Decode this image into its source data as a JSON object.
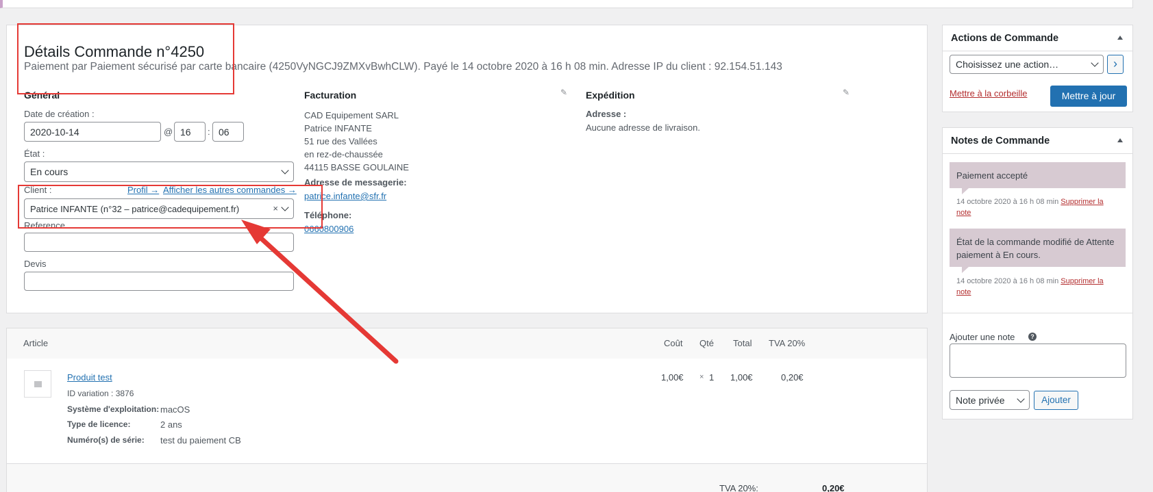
{
  "order": {
    "title": "Détails Commande n°4250",
    "subtitle": "Paiement par Paiement sécurisé par carte bancaire (4250VyNGCJ9ZMXvBwhCLW). Payé le 14 octobre 2020 à 16 h 08 min. Adresse IP du client : 92.154.51.143"
  },
  "general": {
    "heading": "Général",
    "date_label": "Date de création :",
    "date_value": "2020-10-14",
    "at": "@",
    "hour": "16",
    "colon": ":",
    "minute": "06",
    "state_label": "État :",
    "state_value": "En cours",
    "client_label": "Client :",
    "profile_link": "Profil →",
    "other_orders_link": "Afficher les autres commandes →",
    "client_value": "Patrice INFANTE (n°32 – patrice@cadequipement.fr)",
    "clear": "×",
    "reference_label": "Reference",
    "reference_value": "",
    "devis_label": "Devis",
    "devis_value": ""
  },
  "billing": {
    "heading": "Facturation",
    "lines": [
      "CAD Equipement SARL",
      "Patrice INFANTE",
      "51 rue des Vallées",
      "en rez-de-chaussée",
      "44115 BASSE GOULAINE"
    ],
    "email_label": "Adresse de messagerie:",
    "email": "patrice.infante@sfr.fr",
    "phone_label": "Téléphone:",
    "phone": "0660800906"
  },
  "shipping": {
    "heading": "Expédition",
    "address_label": "Adresse :",
    "address_value": "Aucune adresse de livraison."
  },
  "actions": {
    "heading": "Actions de Commande",
    "select_value": "Choisissez une action…",
    "go": "›",
    "trash": "Mettre à la corbeille",
    "update": "Mettre à jour"
  },
  "notes": {
    "heading": "Notes de Commande",
    "items": [
      {
        "text": "Paiement accepté",
        "date": "14 octobre 2020 à 16 h 08 min",
        "delete_a": "Supprimer la",
        "delete_b": "note"
      },
      {
        "text": "État de la commande modifié de Attente paiement à En cours.",
        "date": "14 octobre 2020 à 16 h 08 min",
        "delete_a": "Supprimer la",
        "delete_b": "note"
      }
    ],
    "add_label": "Ajouter une note",
    "help": "?",
    "type_value": "Note privée",
    "add_button": "Ajouter"
  },
  "items": {
    "headers": {
      "article": "Article",
      "cost": "Coût",
      "qty": "Qté",
      "total": "Total",
      "vat": "TVA 20%"
    },
    "product": {
      "name": "Produit test",
      "variation": "ID variation : 3876",
      "meta": [
        {
          "key": "Système d'exploitation:",
          "value": "macOS"
        },
        {
          "key": "Type de licence:",
          "value": "2 ans"
        },
        {
          "key": "Numéro(s) de série:",
          "value": "test du paiement CB"
        }
      ],
      "cost": "1,00€",
      "qty_x": "×",
      "qty": "1",
      "total": "1,00€",
      "vat": "0,20€"
    },
    "footer": {
      "vat_label": "TVA 20%:",
      "vat_value": "0,20€"
    }
  },
  "colors": {
    "accent": "#2271b1",
    "annotation": "#e53935",
    "note_bg": "#d7cad2"
  }
}
